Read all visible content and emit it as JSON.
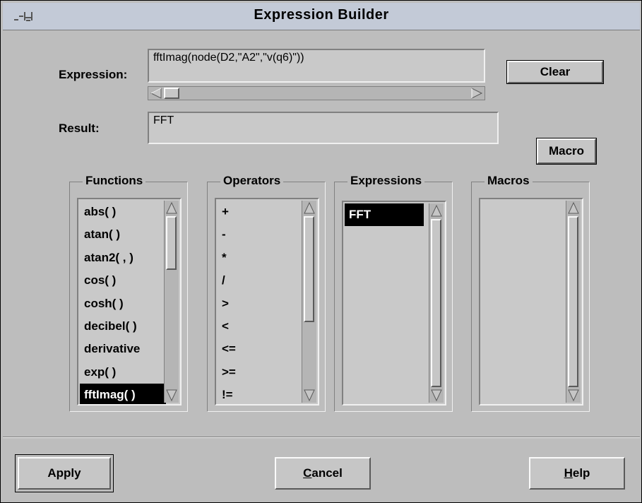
{
  "window": {
    "title": "Expression Builder"
  },
  "expression": {
    "label": "Expression:",
    "value": "fftImag(node(D2,\"A2\",\"v(q6)\"))"
  },
  "result": {
    "label": "Result:",
    "value": "FFT"
  },
  "buttons": {
    "clear": "Clear",
    "macro": "Macro",
    "apply": "Apply",
    "cancel_mnemonic": "C",
    "cancel_rest": "ancel",
    "help_mnemonic": "H",
    "help_rest": "elp"
  },
  "functions": {
    "title": "Functions",
    "items": [
      "abs( )",
      "atan( )",
      "atan2( , )",
      "cos( )",
      "cosh( )",
      "decibel( )",
      "derivative",
      "exp( )",
      "fftImag( )"
    ],
    "selected_index": 8
  },
  "operators": {
    "title": "Operators",
    "items": [
      "+",
      "-",
      "*",
      "/",
      ">",
      "<",
      "<=",
      ">=",
      "!="
    ]
  },
  "expressions": {
    "title": "Expressions",
    "items": [
      "FFT"
    ],
    "selected_index": 0
  },
  "macros": {
    "title": "Macros",
    "items": []
  }
}
